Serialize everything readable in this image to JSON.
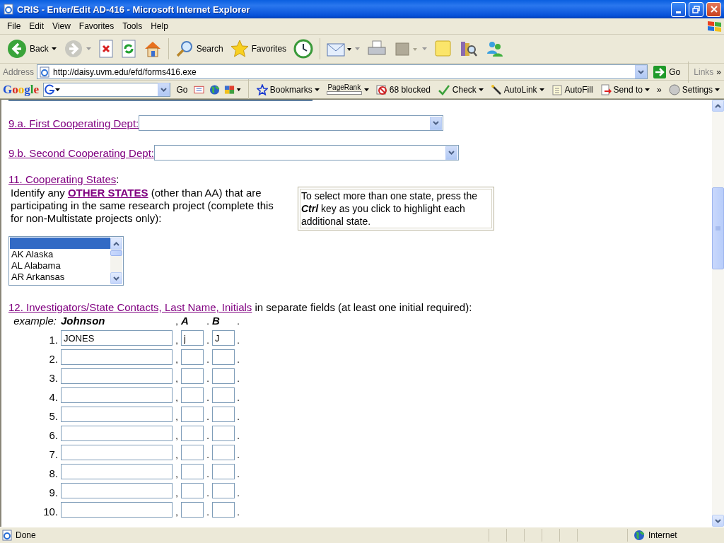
{
  "window": {
    "title": "CRIS - Enter/Edit AD-416 - Microsoft Internet Explorer"
  },
  "menu": [
    "File",
    "Edit",
    "View",
    "Favorites",
    "Tools",
    "Help"
  ],
  "toolbar": [
    {
      "kind": "back",
      "label": "Back"
    },
    {
      "kind": "forward"
    },
    {
      "kind": "stop"
    },
    {
      "kind": "refresh"
    },
    {
      "kind": "home"
    },
    {
      "kind": "search",
      "label": "Search"
    },
    {
      "kind": "favorites",
      "label": "Favorites"
    },
    {
      "kind": "history"
    },
    {
      "kind": "mail"
    },
    {
      "kind": "print"
    },
    {
      "kind": "edit"
    },
    {
      "kind": "note"
    },
    {
      "kind": "research"
    },
    {
      "kind": "messenger"
    }
  ],
  "address_bar": {
    "label": "Address",
    "url": "http://daisy.uvm.edu/efd/forms416.exe",
    "go": "Go",
    "links": "Links",
    "more": "»"
  },
  "google_bar": {
    "logo": "Google",
    "go": "Go",
    "items": [
      {
        "kind": "bookmarks",
        "label": "Bookmarks"
      },
      {
        "kind": "pagerank",
        "label": "PageRank"
      },
      {
        "kind": "blocked",
        "label": "68 blocked"
      },
      {
        "kind": "check",
        "label": "Check"
      },
      {
        "kind": "autolink",
        "label": "AutoLink"
      },
      {
        "kind": "autofill",
        "label": "AutoFill"
      },
      {
        "kind": "sendto",
        "label": "Send to"
      },
      {
        "kind": "more",
        "label": "»"
      },
      {
        "kind": "settings",
        "label": "Settings"
      }
    ]
  },
  "form": {
    "dept_fields": [
      {
        "label": "9.a. First Cooperating Dept:"
      },
      {
        "label": "9.b. Second Cooperating Dept:"
      }
    ],
    "states": {
      "heading": "11. Cooperating States",
      "heading_suffix": ":",
      "intro_before": "Identify any",
      "intro_link": "OTHER STATES",
      "intro_after": "(other than AA) that are participating in the same research project (complete this for non-Multistate projects only):",
      "tip": "To select more than one state, press the **Ctrl** key as you click to highlight each additional state.",
      "options": [
        {
          "selected": true
        },
        {
          "label": "AK Alaska",
          "selected": false
        },
        {
          "label": "AL Alabama",
          "selected": false
        },
        {
          "label": "AR Arkansas",
          "selected": false
        }
      ]
    },
    "investigators": {
      "heading": "12. Investigators/State Contacts, Last Name, Initials",
      "heading_after": "in separate fields (at least one initial required):",
      "example": {
        "label": "example:",
        "last": "Johnson",
        "sep_1": ",",
        "initial_a": "A",
        "sep_2": ".",
        "initial_b": "B",
        "sep_3": "."
      },
      "rows": [
        {
          "number": "1.",
          "last": "JONES",
          "sep_1": ",",
          "initial_a": "j",
          "sep_2": ".",
          "initial_b": "J",
          "sep_3": "."
        },
        {
          "number": "2.",
          "sep_1": ",",
          "sep_2": ".",
          "sep_3": "."
        },
        {
          "number": "3.",
          "sep_1": ",",
          "sep_2": ".",
          "sep_3": "."
        },
        {
          "number": "4.",
          "sep_1": ",",
          "sep_2": ".",
          "sep_3": "."
        },
        {
          "number": "5.",
          "sep_1": ",",
          "sep_2": ".",
          "sep_3": "."
        },
        {
          "number": "6.",
          "sep_1": ",",
          "sep_2": ".",
          "sep_3": "."
        },
        {
          "number": "7.",
          "sep_1": ",",
          "sep_2": ".",
          "sep_3": "."
        },
        {
          "number": "8.",
          "sep_1": ",",
          "sep_2": ".",
          "sep_3": "."
        },
        {
          "number": "9.",
          "sep_1": ",",
          "sep_2": ".",
          "sep_3": "."
        },
        {
          "number": "10.",
          "sep_1": ",",
          "sep_2": ".",
          "sep_3": "."
        }
      ]
    }
  },
  "status_bar": {
    "text": "Done",
    "zone": "Internet"
  }
}
